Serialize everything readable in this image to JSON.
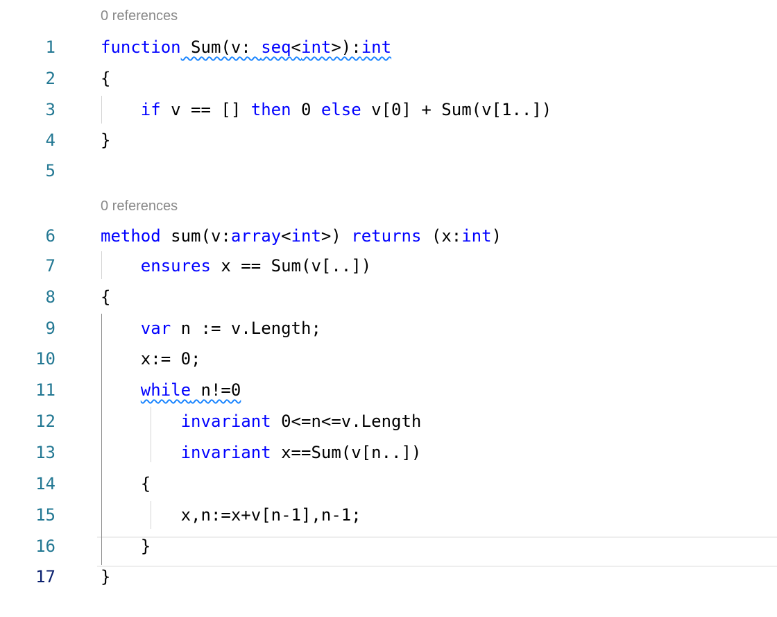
{
  "codelens": {
    "sum_function": "0 references",
    "sum_method": "0 references"
  },
  "line_numbers": [
    "1",
    "2",
    "3",
    "4",
    "5",
    "6",
    "7",
    "8",
    "9",
    "10",
    "11",
    "12",
    "13",
    "14",
    "15",
    "16",
    "17"
  ],
  "code": {
    "l1": {
      "kw": "function",
      "rest": " Sum(v: ",
      "seq": "seq",
      "lt": "<",
      "int": "int",
      "gt": ">):",
      "ret": "int"
    },
    "l2": {
      "text": "{"
    },
    "l3": {
      "indent": "    ",
      "if": "if",
      "a": " v == [] ",
      "then": "then",
      "b": " 0 ",
      "else": "else",
      "c": " v[0] + Sum(v[1..])"
    },
    "l4": {
      "text": "}"
    },
    "l6": {
      "method": "method",
      "a": " sum(v:",
      "array": "array",
      "b": "<",
      "int": "int",
      "c": ">) ",
      "returns": "returns",
      "d": " (x:",
      "int2": "int",
      "e": ")"
    },
    "l7": {
      "indent": "    ",
      "ensures": "ensures",
      "a": " x == Sum(v[..])"
    },
    "l8": {
      "text": "{"
    },
    "l9": {
      "indent": "    ",
      "var": "var",
      "a": " n := v.Length;"
    },
    "l10": {
      "text": "    x:= 0;"
    },
    "l11": {
      "indent": "    ",
      "while": "while",
      "a": " n!=0"
    },
    "l12": {
      "indent": "        ",
      "invariant": "invariant",
      "a": " 0<=n<=v.Length"
    },
    "l13": {
      "indent": "        ",
      "invariant": "invariant",
      "a": " x==Sum(v[n..])"
    },
    "l14": {
      "text": "    {"
    },
    "l15": {
      "text": "        x,n:=x+v[n-1],n-1;"
    },
    "l16": {
      "text": "    }"
    },
    "l17": {
      "text": "}"
    }
  },
  "colors": {
    "keyword": "#0000ff",
    "line_number": "#237893",
    "active_line_number": "#0b216f",
    "codelens": "#8a8a8a",
    "squiggle": "#1a85ff"
  }
}
